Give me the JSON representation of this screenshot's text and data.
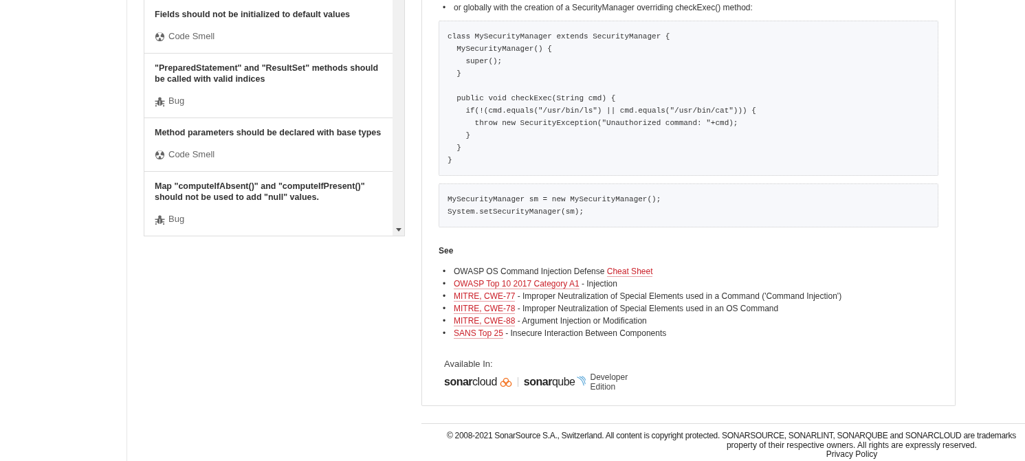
{
  "rules": [
    {
      "title": "Fields should not be initialized to default values",
      "type": {
        "kind": "code_smell",
        "label": "Code Smell"
      }
    },
    {
      "title": "\"PreparedStatement\" and \"ResultSet\" methods should be called with valid indices",
      "type": {
        "kind": "bug",
        "label": "Bug"
      }
    },
    {
      "title": "Method parameters should be declared with base types",
      "type": {
        "kind": "code_smell",
        "label": "Code Smell"
      }
    },
    {
      "title": "Map \"computeIfAbsent()\" and \"computeIfPresent()\" should not be used to add \"null\" values.",
      "type": {
        "kind": "bug",
        "label": "Bug"
      }
    }
  ],
  "description": {
    "intro_marker": "•",
    "intro_bullet": "or globally with the creation of a SecurityManager overriding checkExec() method:",
    "code_blocks": [
      "class MySecurityManager extends SecurityManager {\n  MySecurityManager() {\n    super();\n  }\n\n  public void checkExec(String cmd) {\n    if(!(cmd.equals(\"/usr/bin/ls\") || cmd.equals(\"/usr/bin/cat\"))) {\n      throw new SecurityException(\"Unauthorized command: \"+cmd);\n    }\n  }\n}",
      "MySecurityManager sm = new MySecurityManager();\nSystem.setSecurityManager(sm);"
    ],
    "see": {
      "heading": "See",
      "items": [
        {
          "marker": "•",
          "parts": [
            {
              "text": "OWASP OS Command Injection Defense ",
              "link": false
            },
            {
              "text": "Cheat Sheet",
              "link": true
            }
          ]
        },
        {
          "marker": "•",
          "parts": [
            {
              "text": "OWASP Top 10 2017 Category A1",
              "link": true
            },
            {
              "text": " - Injection",
              "link": false
            }
          ]
        },
        {
          "marker": "•",
          "parts": [
            {
              "text": "MITRE, CWE-77",
              "link": true
            },
            {
              "text": " - Improper Neutralization of Special Elements used in a Command ('Command Injection')",
              "link": false
            }
          ]
        },
        {
          "marker": "•",
          "parts": [
            {
              "text": "MITRE, CWE-78",
              "link": true
            },
            {
              "text": " - Improper Neutralization of Special Elements used in an OS Command",
              "link": false
            }
          ]
        },
        {
          "marker": "•",
          "parts": [
            {
              "text": "MITRE, CWE-88",
              "link": true
            },
            {
              "text": " - Argument Injection or Modification",
              "link": false
            }
          ]
        },
        {
          "marker": "•",
          "parts": [
            {
              "text": "SANS Top 25",
              "link": true
            },
            {
              "text": " - Insecure Interaction Between Components",
              "link": false
            }
          ]
        }
      ]
    },
    "available_in": {
      "label": "Available In:",
      "products": [
        {
          "kind": "cloud",
          "name_bold": "sonar",
          "name_light": "cloud"
        },
        {
          "kind": "qube",
          "name_bold": "sonar",
          "name_light": "qube",
          "edition": "Developer Edition"
        }
      ]
    }
  },
  "footer": {
    "lines": [
      "© 2008-2021 SonarSource S.A., Switzerland. All content is copyright protected. SONARSOURCE, SONARLINT, SONARQUBE and SONARCLOUD are trademarks",
      "property of their respective owners. All rights are expressly reserved.",
      "Privacy Policy"
    ]
  }
}
